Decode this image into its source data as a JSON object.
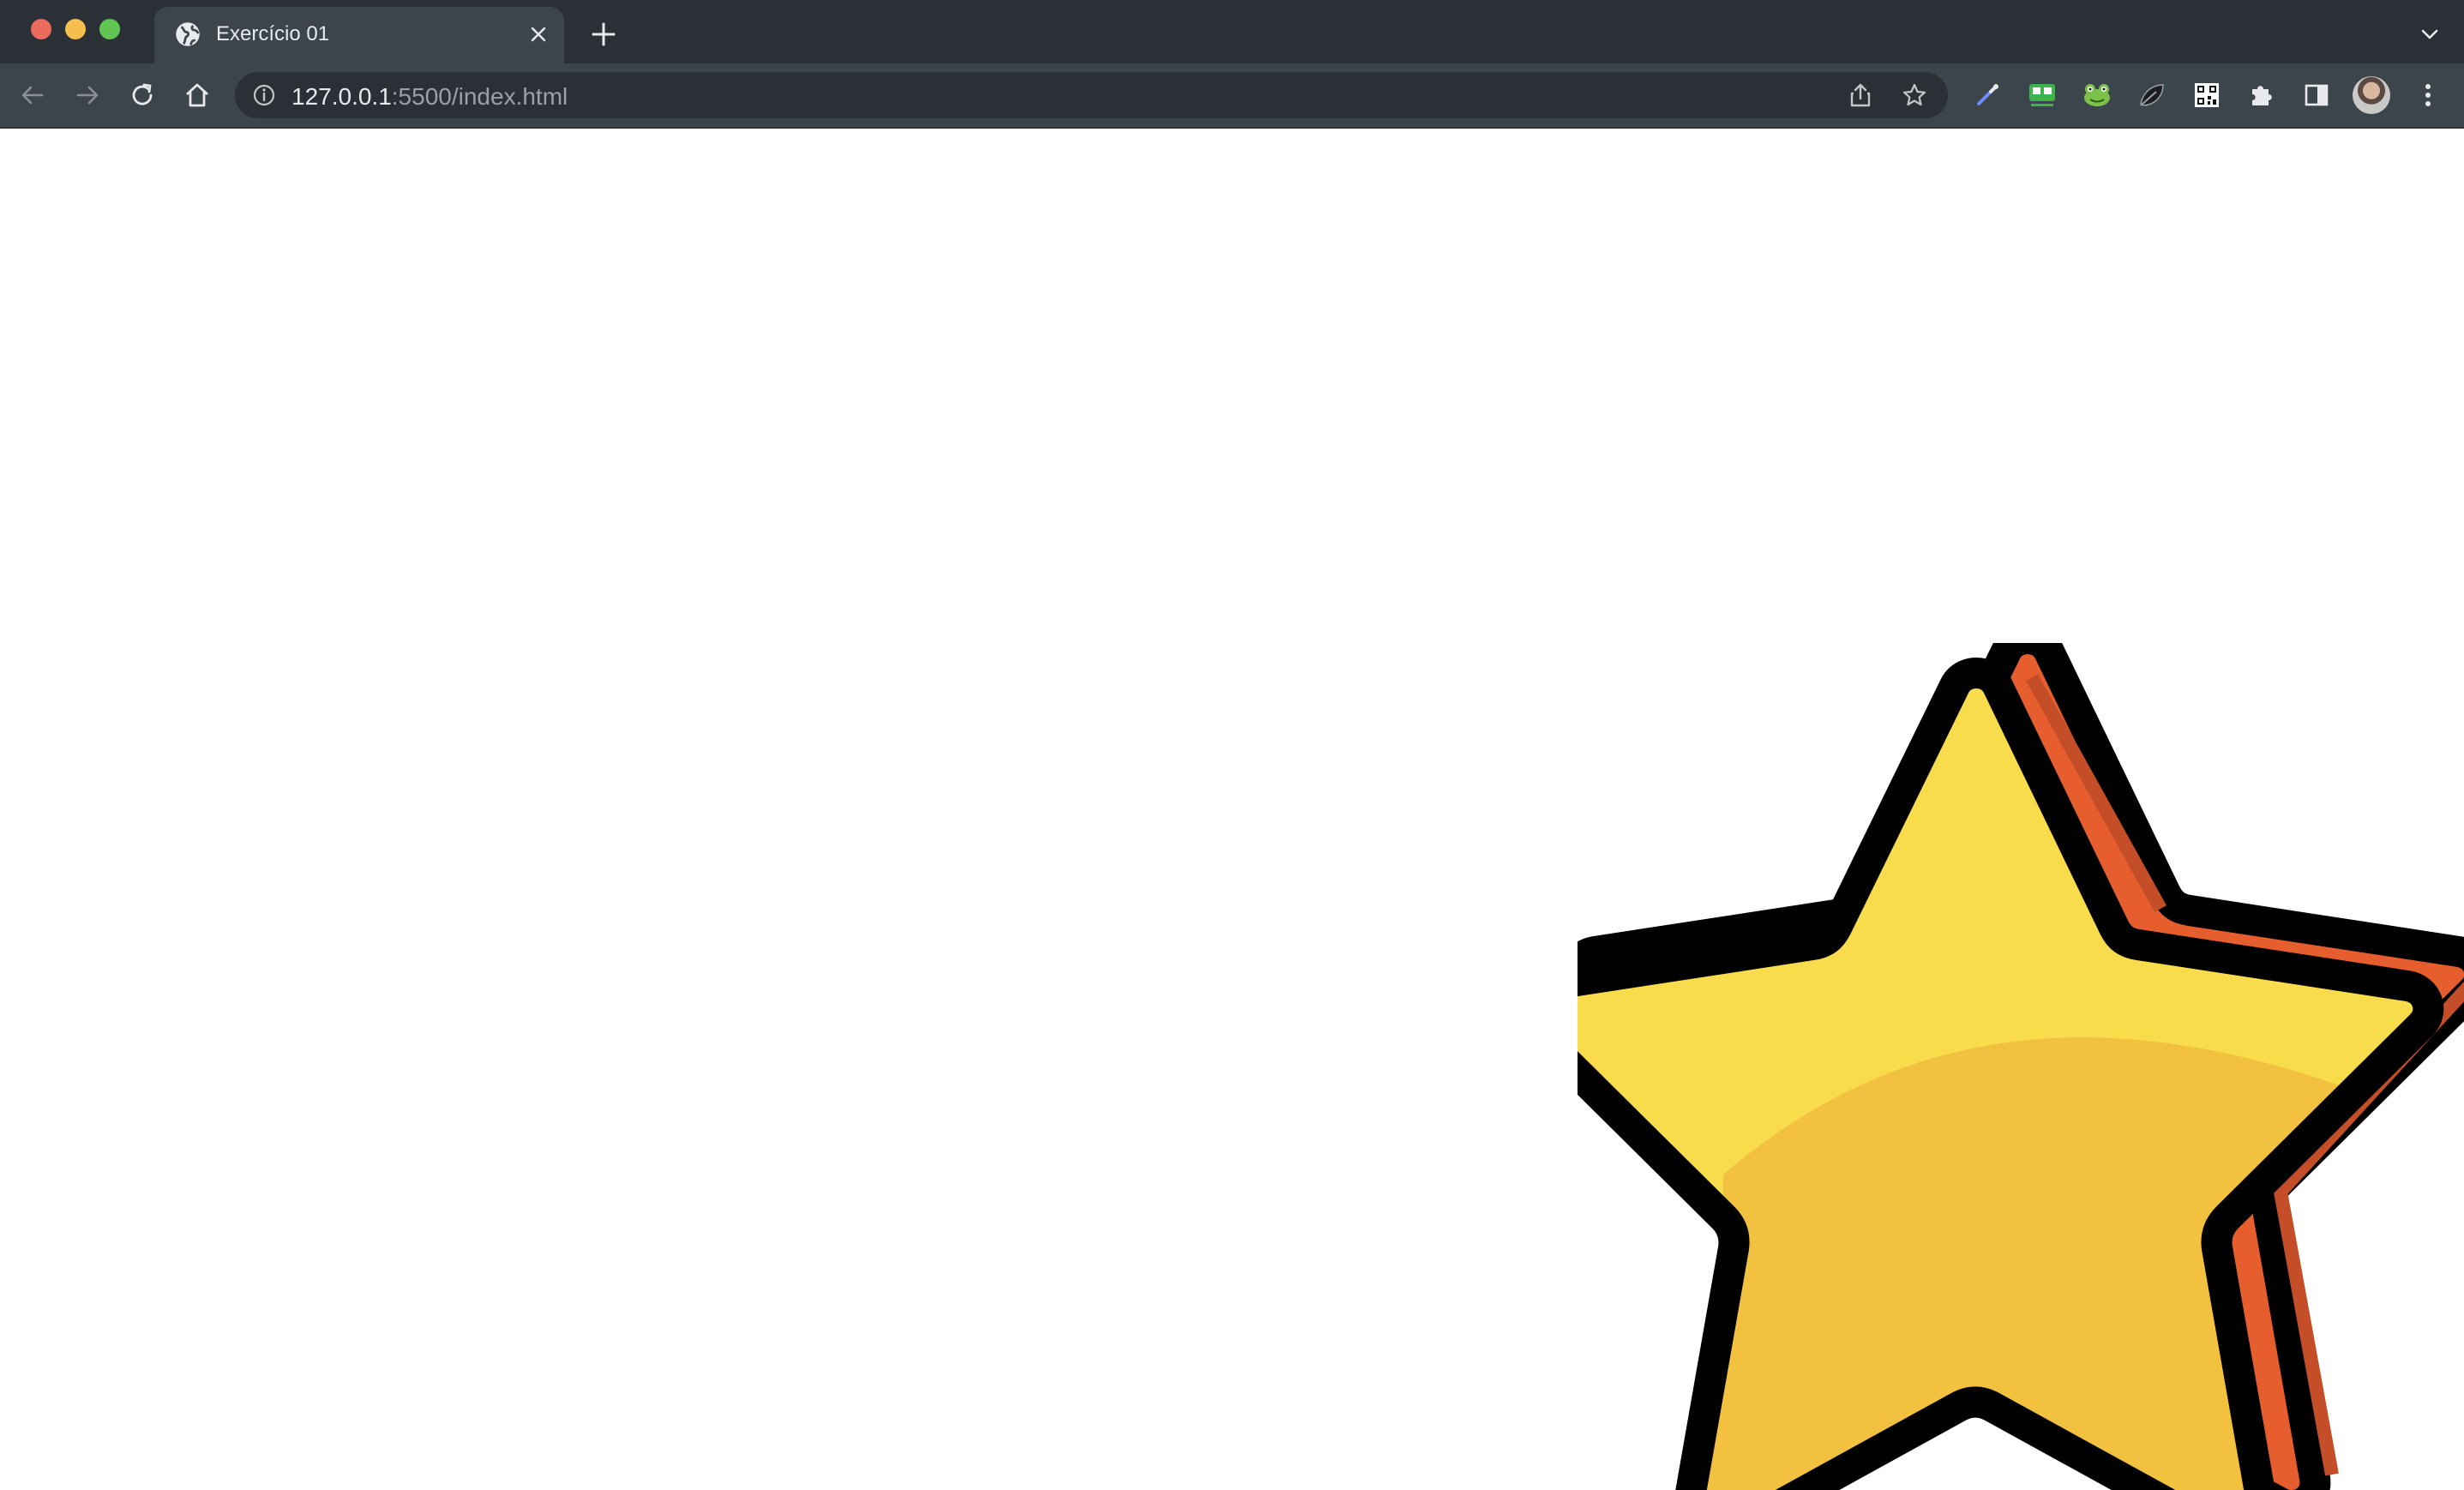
{
  "window": {
    "traffic_lights": {
      "close_color": "#ed6a5e",
      "minimize_color": "#f5bf4f",
      "zoom_color": "#61c554"
    }
  },
  "tabs": [
    {
      "title": "Exercício 01",
      "favicon": "globe-icon",
      "active": true
    }
  ],
  "toolbar": {
    "back_icon": "arrow-left-icon",
    "forward_icon": "arrow-right-icon",
    "reload_icon": "reload-icon",
    "home_icon": "home-icon"
  },
  "omnibox": {
    "url_host": "127.0.0.1",
    "url_rest": ":5500/index.html",
    "info_icon": "info-icon",
    "share_icon": "share-icon",
    "bookmark_icon": "star-outline-icon"
  },
  "extensions": [
    "eyedropper-icon",
    "tv-extension-icon",
    "frog-extension-icon",
    "leaf-extension-icon",
    "qr-code-icon",
    "puzzle-icon",
    "side-panel-icon"
  ],
  "page": {
    "image": "star-illustration",
    "colors": {
      "star_fill": "#f8dc4c",
      "star_shade": "#f2c13f",
      "star_side": "#e65e2e",
      "outline": "#000000"
    }
  }
}
